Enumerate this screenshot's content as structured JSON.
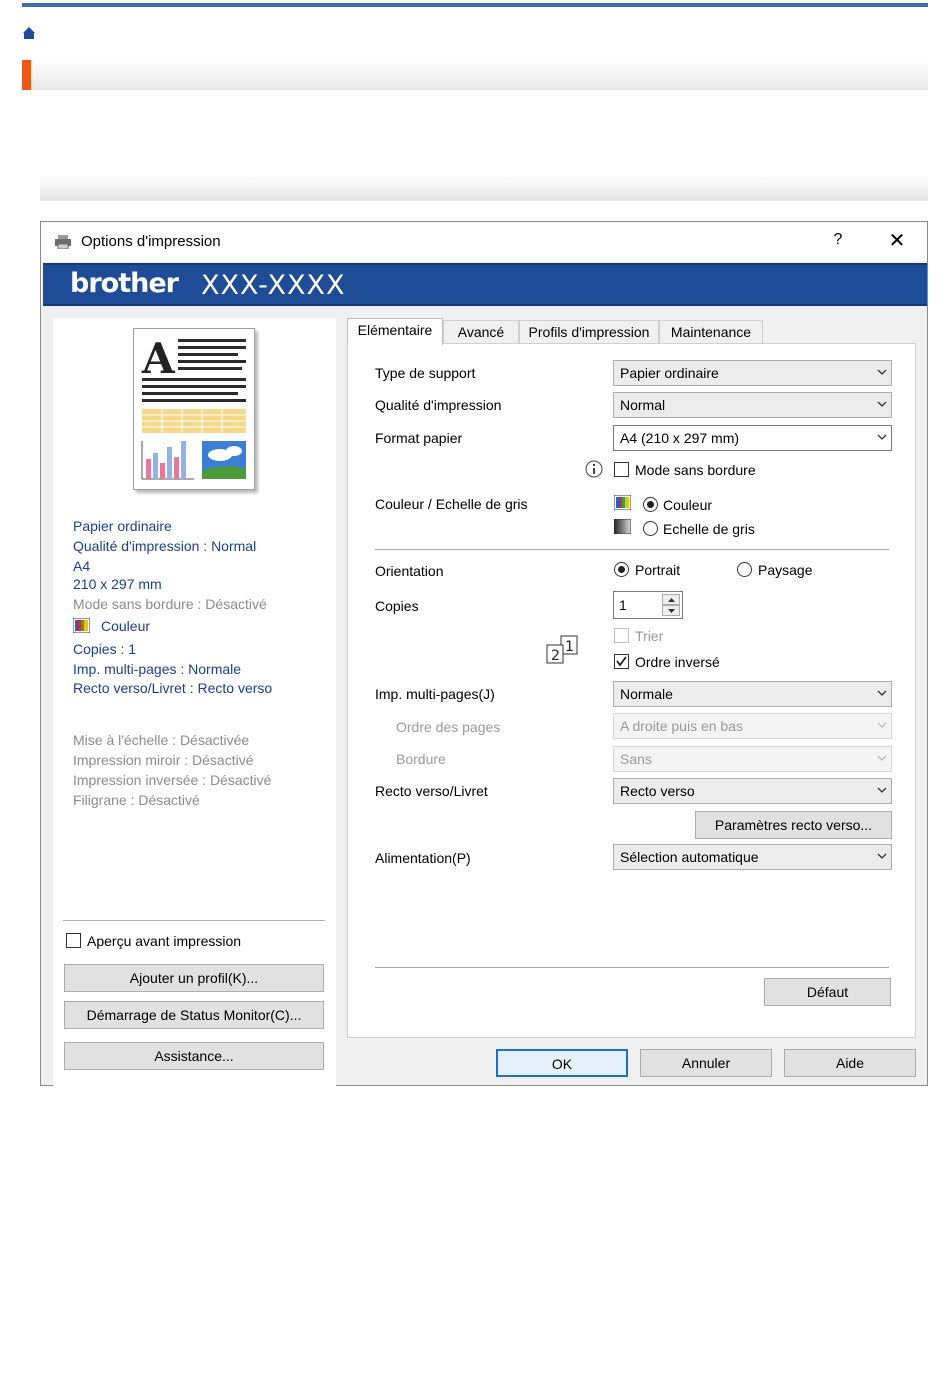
{
  "page": {
    "accent_blue": "#3f6bb5",
    "accent_orange": "#e8591a",
    "home_icon": "home-icon"
  },
  "dialog": {
    "title": "Options d'impression",
    "help_label": "?",
    "close_label": "✕",
    "brand": "brother",
    "model": "XXX-XXXX",
    "banner_color": "#1f4c97"
  },
  "summary": {
    "media": "Papier ordinaire",
    "quality": "Qualité d'impression : Normal",
    "paper": "A4",
    "size": "210 x 297 mm",
    "borderless": "Mode sans bordure : Désactivé",
    "color": "Couleur",
    "copies": "Copies : 1",
    "multipage": "Imp. multi-pages : Normale",
    "duplex": "Recto verso/Livret : Recto verso",
    "scaling": "Mise à l'échelle : Désactivée",
    "mirror": "Impression miroir : Désactivé",
    "reverse": "Impression inversée : Désactivé",
    "watermark": "Filigrane : Désactivé"
  },
  "left_controls": {
    "preview_check": "Aperçu avant impression",
    "add_profile": "Ajouter un profil(K)...",
    "status_monitor": "Démarrage de Status Monitor(C)...",
    "assistance": "Assistance..."
  },
  "tabs": [
    "Elémentaire",
    "Avancé",
    "Profils d'impression",
    "Maintenance"
  ],
  "basic": {
    "media_type_label": "Type de support",
    "media_type_value": "Papier ordinaire",
    "quality_label": "Qualité d'impression",
    "quality_value": "Normal",
    "paper_size_label": "Format papier",
    "paper_size_value": "A4 (210 x 297 mm)",
    "borderless_label": "Mode sans bordure",
    "color_label": "Couleur / Echelle de gris",
    "color_opt": "Couleur",
    "gray_opt": "Echelle de gris",
    "orientation_label": "Orientation",
    "portrait": "Portrait",
    "landscape": "Paysage",
    "copies_label": "Copies",
    "copies_value": "1",
    "collate": "Trier",
    "reverse_order": "Ordre inversé",
    "multipage_label": "Imp. multi-pages(J)",
    "multipage_value": "Normale",
    "page_order_label": "Ordre des pages",
    "page_order_value": "A droite puis en bas",
    "border_label": "Bordure",
    "border_value": "Sans",
    "duplex_label": "Recto verso/Livret",
    "duplex_value": "Recto verso",
    "duplex_settings": "Paramètres recto verso...",
    "source_label": "Alimentation(P)",
    "source_value": "Sélection automatique",
    "default_button": "Défaut"
  },
  "footer": {
    "ok": "OK",
    "cancel": "Annuler",
    "help": "Aide"
  }
}
